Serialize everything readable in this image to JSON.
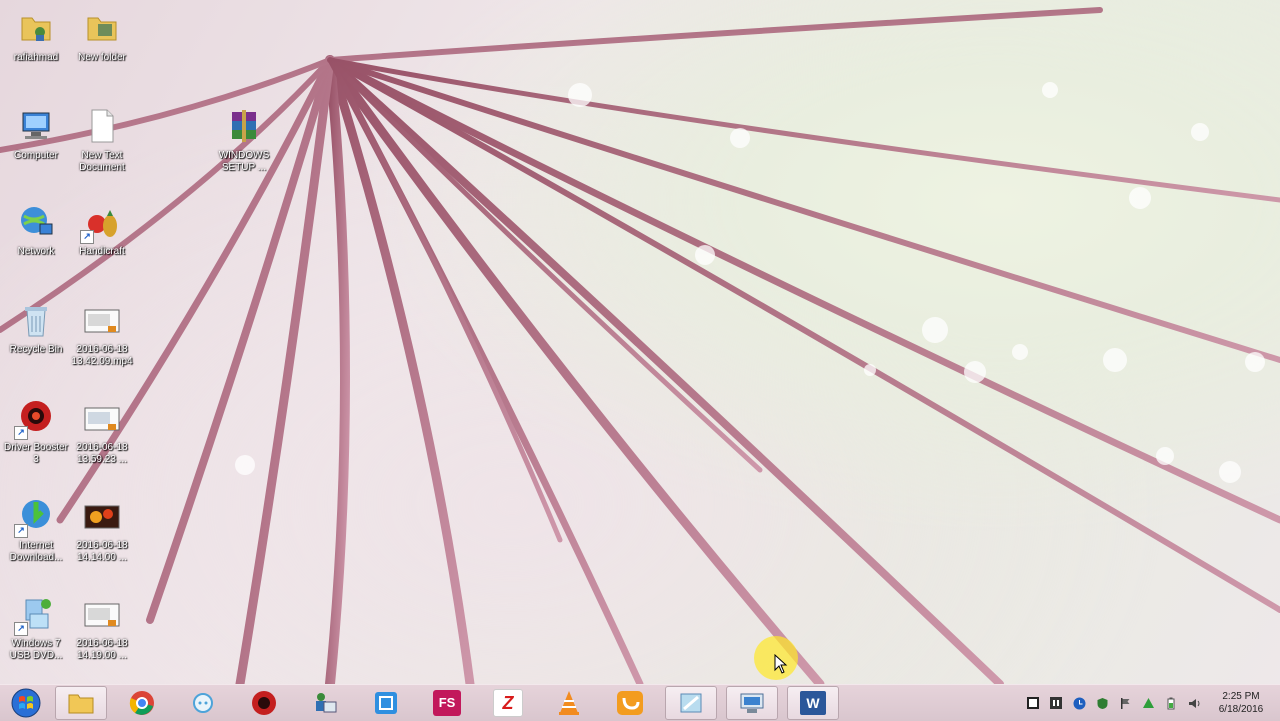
{
  "desktop": {
    "icons": [
      {
        "name": "folder-icon",
        "label": "rafiahmad"
      },
      {
        "name": "folder-icon",
        "label": "New folder"
      },
      {
        "name": "computer-icon",
        "label": "Computer"
      },
      {
        "name": "text-document-icon",
        "label": "New Text Document"
      },
      {
        "name": "winrar-archive-icon",
        "label": "WINDOWS SETUP ..."
      },
      {
        "name": "network-icon",
        "label": "Network"
      },
      {
        "name": "handicraft-icon",
        "label": "Handicraft"
      },
      {
        "name": "recycle-bin-icon",
        "label": "Recycle Bin"
      },
      {
        "name": "screenshot-file-icon",
        "label": "2016-06-18 13.42.09.mp4"
      },
      {
        "name": "driver-booster-icon",
        "label": "Driver Booster 3"
      },
      {
        "name": "screenshot-file-icon",
        "label": "2016-06-18 13.59.23 ..."
      },
      {
        "name": "internet-download-manager-icon",
        "label": "Internet Download..."
      },
      {
        "name": "video-file-icon",
        "label": "2016-06-18 14.14.00 ..."
      },
      {
        "name": "windows7-usb-tool-icon",
        "label": "Windows 7 USB DVD..."
      },
      {
        "name": "screenshot-file-icon",
        "label": "2016-06-18 14.19.00 ..."
      }
    ]
  },
  "taskbar": {
    "start_label": "Start",
    "pinned": [
      {
        "name": "file-explorer-icon",
        "active": true
      },
      {
        "name": "chrome-icon",
        "active": false
      },
      {
        "name": "app-circle-icon",
        "active": false
      },
      {
        "name": "driver-booster-icon",
        "active": false
      },
      {
        "name": "user-tool-icon",
        "active": false
      },
      {
        "name": "screenshot-tool-icon",
        "active": false
      },
      {
        "name": "fs-app-icon",
        "label": "FS",
        "active": false
      },
      {
        "name": "zapya-icon",
        "label": "Z",
        "active": false
      },
      {
        "name": "vlc-icon",
        "active": false
      },
      {
        "name": "uc-browser-icon",
        "active": false
      },
      {
        "name": "window-app-icon",
        "active": true
      },
      {
        "name": "network-window-icon",
        "active": true
      },
      {
        "name": "word-icon",
        "label": "W",
        "active": true
      }
    ],
    "tray": {
      "icons": [
        "stop-icon",
        "pause-icon",
        "clock-app-icon",
        "shield-icon",
        "flag-icon",
        "arrow-up-icon",
        "battery-icon",
        "volume-icon"
      ],
      "time": "2:25 PM",
      "date": "6/18/2016"
    }
  },
  "colors": {
    "taskbar_bg": "#dccbd2",
    "cursor_highlight": "#ffe828",
    "stem_color": "#a8596f"
  }
}
